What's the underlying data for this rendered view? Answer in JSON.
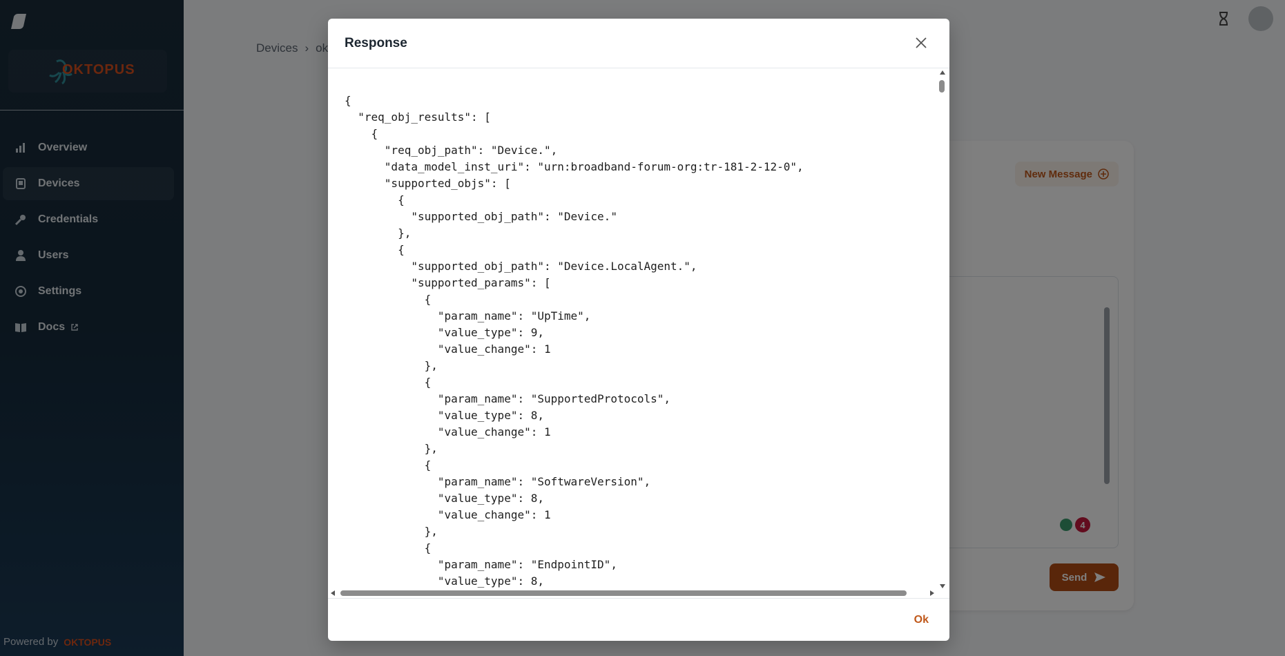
{
  "app": {
    "brand_logo_text": "OKTOPUS",
    "brand_color": "#d94f1c",
    "accent_color": "#b34c14"
  },
  "sidebar": {
    "items": [
      {
        "label": "Overview",
        "icon": "bar-chart-icon"
      },
      {
        "label": "Devices",
        "icon": "device-icon",
        "active": true
      },
      {
        "label": "Credentials",
        "icon": "key-icon"
      },
      {
        "label": "Users",
        "icon": "user-icon"
      },
      {
        "label": "Settings",
        "icon": "gear-icon"
      },
      {
        "label": "Docs",
        "icon": "book-icon",
        "external": true
      }
    ],
    "powered_by": "Powered by"
  },
  "breadcrumb": {
    "root": "Devices",
    "separator": "›",
    "current": "okt"
  },
  "card": {
    "new_message_label": "New Message",
    "badge_count": "4",
    "send_label": "Send"
  },
  "modal": {
    "title": "Response",
    "ok_label": "Ok",
    "code": "{\n  \"req_obj_results\": [\n    {\n      \"req_obj_path\": \"Device.\",\n      \"data_model_inst_uri\": \"urn:broadband-forum-org:tr-181-2-12-0\",\n      \"supported_objs\": [\n        {\n          \"supported_obj_path\": \"Device.\"\n        },\n        {\n          \"supported_obj_path\": \"Device.LocalAgent.\",\n          \"supported_params\": [\n            {\n              \"param_name\": \"UpTime\",\n              \"value_type\": 9,\n              \"value_change\": 1\n            },\n            {\n              \"param_name\": \"SupportedProtocols\",\n              \"value_type\": 8,\n              \"value_change\": 1\n            },\n            {\n              \"param_name\": \"SoftwareVersion\",\n              \"value_type\": 8,\n              \"value_change\": 1\n            },\n            {\n              \"param_name\": \"EndpointID\",\n              \"value_type\": 8,"
  }
}
